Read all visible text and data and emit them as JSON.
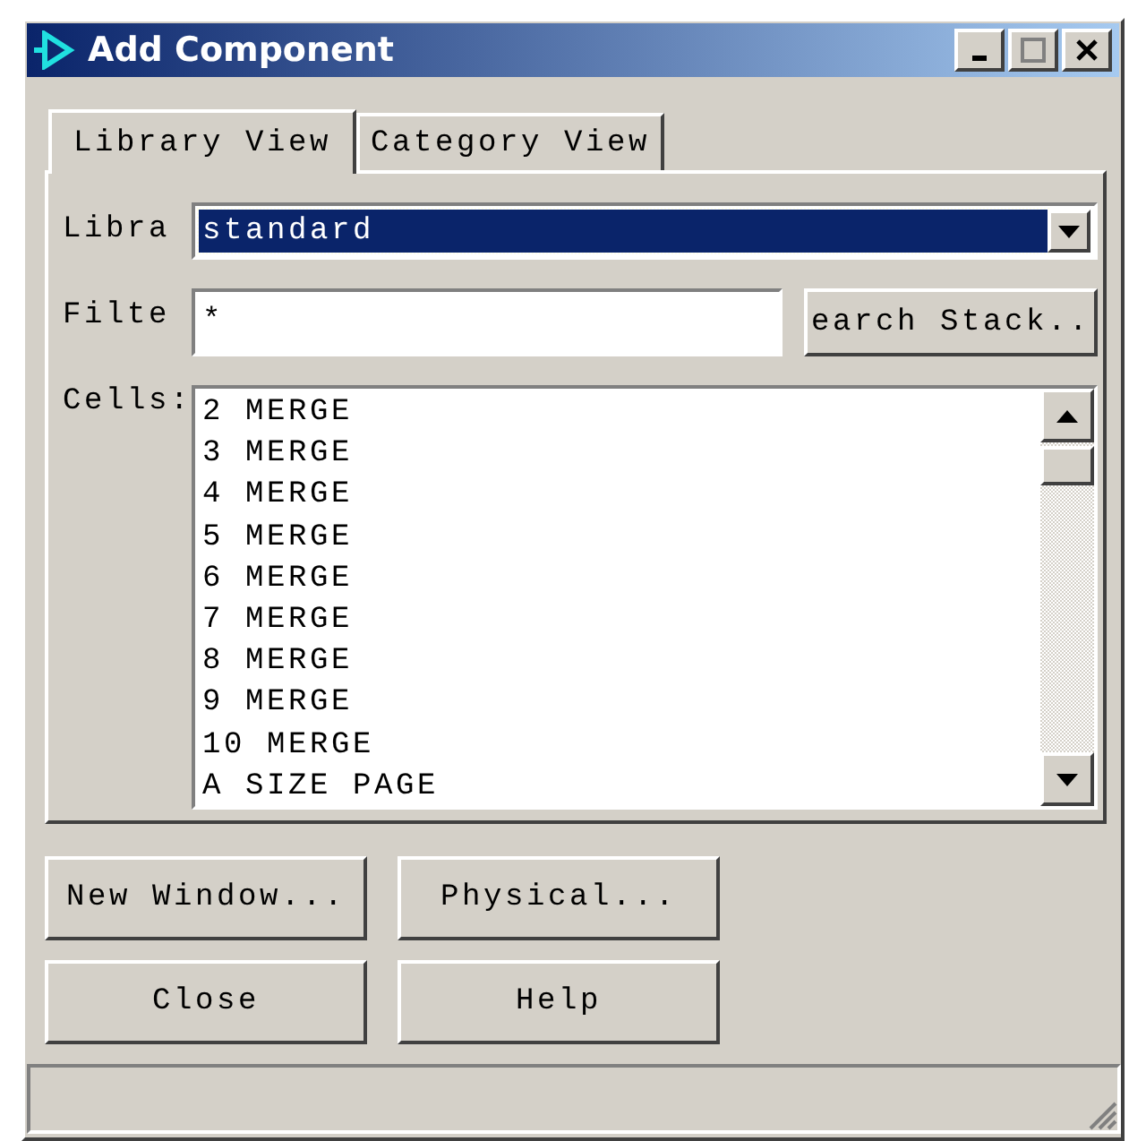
{
  "window": {
    "title": "Add Component"
  },
  "tabs": [
    {
      "label": "Library View",
      "selected": true
    },
    {
      "label": "Category View",
      "selected": false
    }
  ],
  "library": {
    "label": "Libra",
    "value": "standard"
  },
  "filter": {
    "label": "Filte",
    "value": "*",
    "button": "earch Stack.."
  },
  "cells": {
    "label": "Cells:",
    "items": [
      "2 MERGE",
      "3 MERGE",
      "4 MERGE",
      "5 MERGE",
      "6 MERGE",
      "7 MERGE",
      "8 MERGE",
      "9 MERGE",
      "10 MERGE",
      "A SIZE PAGE"
    ]
  },
  "buttons": [
    "New Window...",
    "Physical...",
    "Close",
    "Help"
  ]
}
